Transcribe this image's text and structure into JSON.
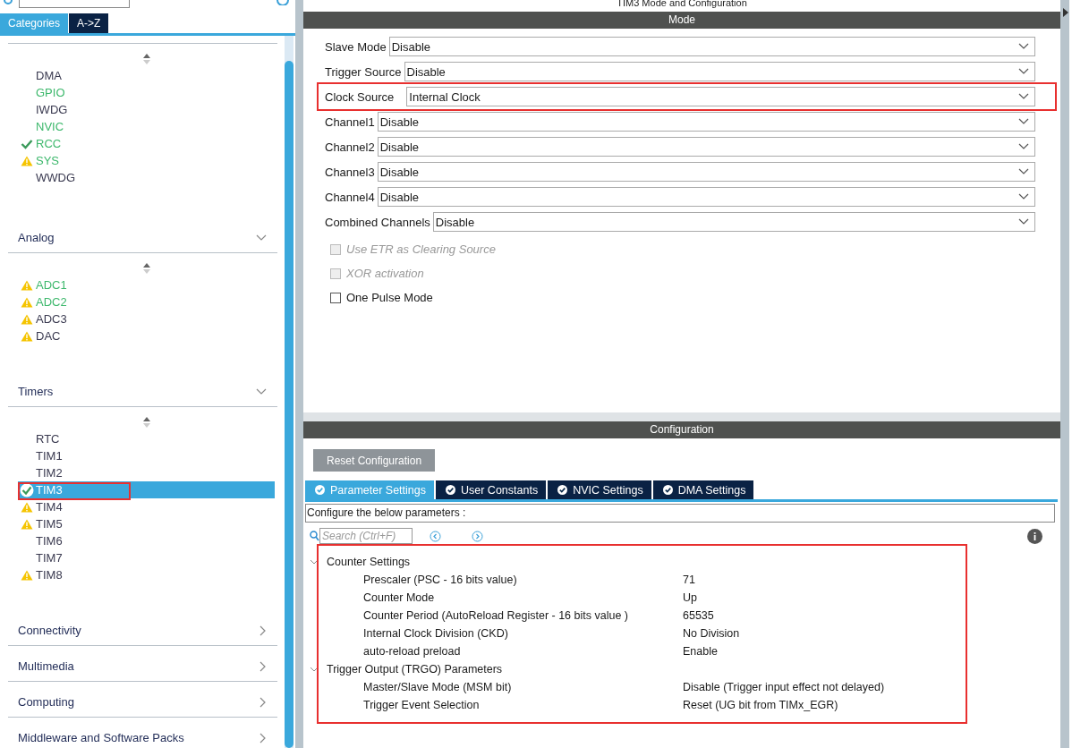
{
  "sidebar": {
    "tabs": [
      {
        "label": "Categories",
        "selected": true
      },
      {
        "label": "A->Z",
        "selected": false
      }
    ],
    "sections": [
      {
        "items": [
          {
            "label": "DMA",
            "configured": false,
            "warning": false,
            "active": false,
            "selected": false,
            "highlighted": false
          },
          {
            "label": "GPIO",
            "configured": false,
            "warning": false,
            "active": true,
            "selected": false,
            "highlighted": false
          },
          {
            "label": "IWDG",
            "configured": false,
            "warning": false,
            "active": false,
            "selected": false,
            "highlighted": false
          },
          {
            "label": "NVIC",
            "configured": false,
            "warning": false,
            "active": true,
            "selected": false,
            "highlighted": false
          },
          {
            "label": "RCC",
            "configured": true,
            "warning": false,
            "active": true,
            "selected": false,
            "highlighted": false
          },
          {
            "label": "SYS",
            "configured": false,
            "warning": true,
            "active": true,
            "selected": false,
            "highlighted": false
          },
          {
            "label": "WWDG",
            "configured": false,
            "warning": false,
            "active": false,
            "selected": false,
            "highlighted": false
          }
        ]
      },
      {
        "title": "Analog",
        "expanded": true,
        "items": [
          {
            "label": "ADC1",
            "configured": false,
            "warning": true,
            "active": true,
            "selected": false,
            "highlighted": false
          },
          {
            "label": "ADC2",
            "configured": false,
            "warning": true,
            "active": true,
            "selected": false,
            "highlighted": false
          },
          {
            "label": "ADC3",
            "configured": false,
            "warning": true,
            "active": false,
            "selected": false,
            "highlighted": false
          },
          {
            "label": "DAC",
            "configured": false,
            "warning": true,
            "active": false,
            "selected": false,
            "highlighted": false
          }
        ]
      },
      {
        "title": "Timers",
        "expanded": true,
        "items": [
          {
            "label": "RTC",
            "configured": false,
            "warning": false,
            "active": false,
            "selected": false,
            "highlighted": false
          },
          {
            "label": "TIM1",
            "configured": false,
            "warning": false,
            "active": false,
            "selected": false,
            "highlighted": false
          },
          {
            "label": "TIM2",
            "configured": false,
            "warning": false,
            "active": false,
            "selected": false,
            "highlighted": false
          },
          {
            "label": "TIM3",
            "configured": true,
            "warning": false,
            "active": false,
            "selected": true,
            "highlighted": true
          },
          {
            "label": "TIM4",
            "configured": false,
            "warning": true,
            "active": false,
            "selected": false,
            "highlighted": false
          },
          {
            "label": "TIM5",
            "configured": false,
            "warning": true,
            "active": false,
            "selected": false,
            "highlighted": false
          },
          {
            "label": "TIM6",
            "configured": false,
            "warning": false,
            "active": false,
            "selected": false,
            "highlighted": false
          },
          {
            "label": "TIM7",
            "configured": false,
            "warning": false,
            "active": false,
            "selected": false,
            "highlighted": false
          },
          {
            "label": "TIM8",
            "configured": false,
            "warning": true,
            "active": false,
            "selected": false,
            "highlighted": false
          }
        ]
      },
      {
        "title": "Connectivity",
        "expanded": false
      },
      {
        "title": "Multimedia",
        "expanded": false
      },
      {
        "title": "Computing",
        "expanded": false
      },
      {
        "title": "Middleware and Software Packs",
        "expanded": false
      }
    ]
  },
  "panel_title": "TIM3 Mode and Configuration",
  "mode": {
    "title": "Mode",
    "fields": [
      {
        "label": "Slave Mode",
        "value": "Disable",
        "highlighted": false
      },
      {
        "label": "Trigger Source",
        "value": "Disable",
        "highlighted": false
      },
      {
        "label": "Clock Source",
        "value": "Internal Clock",
        "highlighted": true
      },
      {
        "label": "Channel1",
        "value": "Disable",
        "highlighted": false
      },
      {
        "label": "Channel2",
        "value": "Disable",
        "highlighted": false
      },
      {
        "label": "Channel3",
        "value": "Disable",
        "highlighted": false
      },
      {
        "label": "Channel4",
        "value": "Disable",
        "highlighted": false
      },
      {
        "label": "Combined Channels",
        "value": "Disable",
        "highlighted": false
      }
    ],
    "checkboxes": [
      {
        "label": "Use ETR as Clearing Source",
        "checked": false,
        "disabled": true
      },
      {
        "label": "XOR activation",
        "checked": false,
        "disabled": true
      },
      {
        "label": "One Pulse Mode",
        "checked": false,
        "disabled": false
      }
    ]
  },
  "configuration": {
    "title": "Configuration",
    "reset_button": "Reset Configuration",
    "tabs": [
      {
        "label": "Parameter Settings",
        "selected": true
      },
      {
        "label": "User Constants",
        "selected": false
      },
      {
        "label": "NVIC Settings",
        "selected": false
      },
      {
        "label": "DMA Settings",
        "selected": false
      }
    ],
    "description": "Configure the below parameters :",
    "search": {
      "placeholder": "Search (Ctrl+F)"
    },
    "highlighted": true,
    "groups": [
      {
        "title": "Counter Settings",
        "expanded": true,
        "params": [
          {
            "name": "Prescaler (PSC - 16 bits value)",
            "value": "71"
          },
          {
            "name": "Counter Mode",
            "value": "Up"
          },
          {
            "name": "Counter Period (AutoReload Register - 16 bits value )",
            "value": "65535"
          },
          {
            "name": "Internal Clock Division (CKD)",
            "value": "No Division"
          },
          {
            "name": "auto-reload preload",
            "value": "Enable"
          }
        ]
      },
      {
        "title": "Trigger Output (TRGO) Parameters",
        "expanded": true,
        "params": [
          {
            "name": "Master/Slave Mode (MSM bit)",
            "value": "Disable (Trigger input effect not delayed)"
          },
          {
            "name": "Trigger Event Selection",
            "value": "Reset (UG bit from TIMx_EGR)"
          }
        ]
      }
    ]
  }
}
